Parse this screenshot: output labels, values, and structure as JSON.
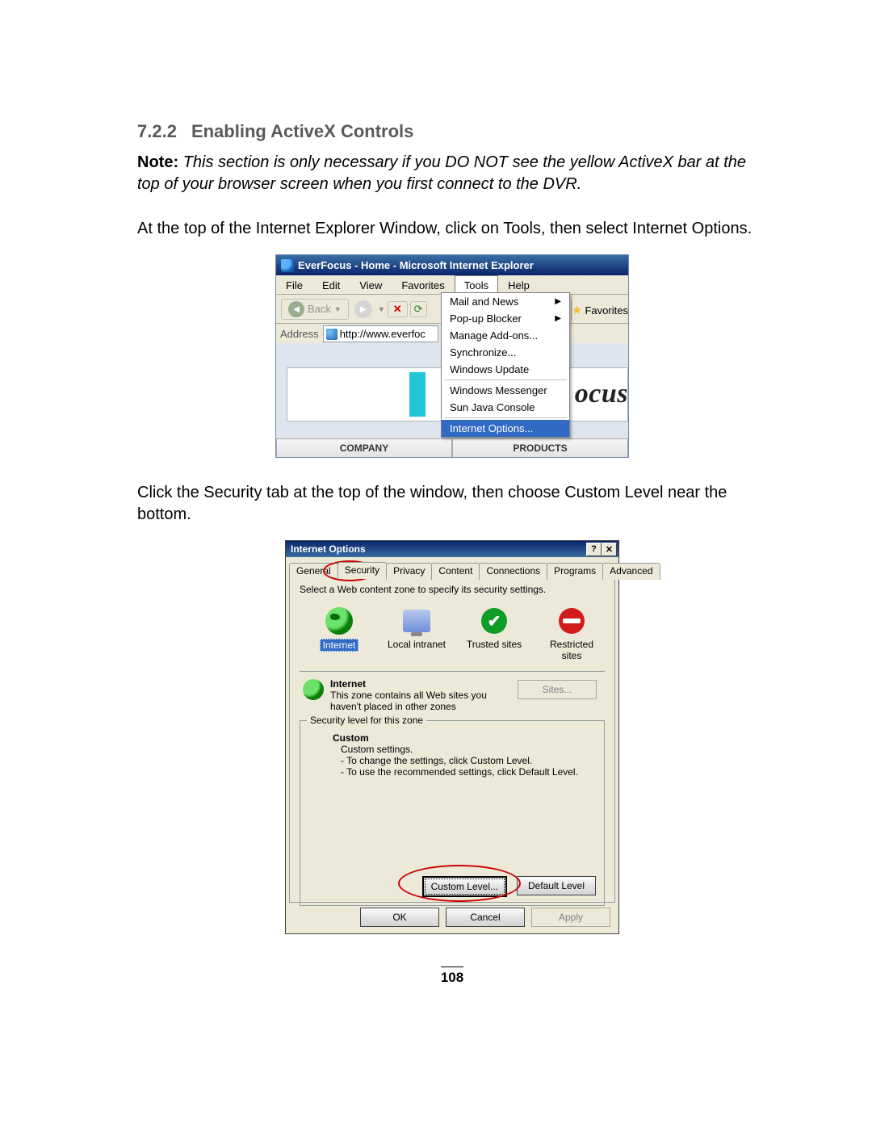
{
  "heading": {
    "number": "7.2.2",
    "title": "Enabling ActiveX Controls"
  },
  "note": {
    "label": "Note:",
    "text": "This section is only necessary if you DO NOT see the yellow ActiveX bar at the top of your browser screen when you first connect to the DVR."
  },
  "para1": "At the top of the Internet Explorer Window, click on Tools, then select Internet Options.",
  "para2": "Click the Security tab at the top of the window, then choose Custom Level near the bottom.",
  "ie": {
    "title": "EverFocus - Home - Microsoft Internet Explorer",
    "menubar": [
      "File",
      "Edit",
      "View",
      "Favorites",
      "Tools",
      "Help"
    ],
    "back_label": "Back",
    "favorites_label": "Favorites",
    "address_label": "Address",
    "address_value": "http://www.everfoc",
    "tools_menu": {
      "items": [
        "Mail and News",
        "Pop-up Blocker",
        "Manage Add-ons...",
        "Synchronize...",
        "Windows Update"
      ],
      "items2": [
        "Windows Messenger",
        "Sun Java Console"
      ],
      "selected": "Internet Options..."
    },
    "banner_partial": "ocus",
    "bottom_tabs": [
      "COMPANY",
      "PRODUCTS"
    ]
  },
  "io": {
    "title": "Internet Options",
    "help_btn": "?",
    "close_btn": "✕",
    "tabs": [
      "General",
      "Security",
      "Privacy",
      "Content",
      "Connections",
      "Programs",
      "Advanced"
    ],
    "active_tab_index": 1,
    "instruction": "Select a Web content zone to specify its security settings.",
    "zones": [
      {
        "label": "Internet",
        "selected": true
      },
      {
        "label": "Local intranet",
        "selected": false
      },
      {
        "label": "Trusted sites",
        "selected": false
      },
      {
        "label": "Restricted sites",
        "selected": false
      }
    ],
    "zone_desc_title": "Internet",
    "zone_desc_text": "This zone contains all Web sites you haven't placed in other zones",
    "sites_btn": "Sites...",
    "sec_level_legend": "Security level for this zone",
    "custom_heading": "Custom",
    "custom_line1": "Custom settings.",
    "custom_line2": "- To change the settings, click Custom Level.",
    "custom_line3": "- To use the recommended settings, click Default Level.",
    "custom_level_btn": "Custom Level...",
    "default_level_btn": "Default Level",
    "ok_btn": "OK",
    "cancel_btn": "Cancel",
    "apply_btn": "Apply"
  },
  "page_number": "108"
}
